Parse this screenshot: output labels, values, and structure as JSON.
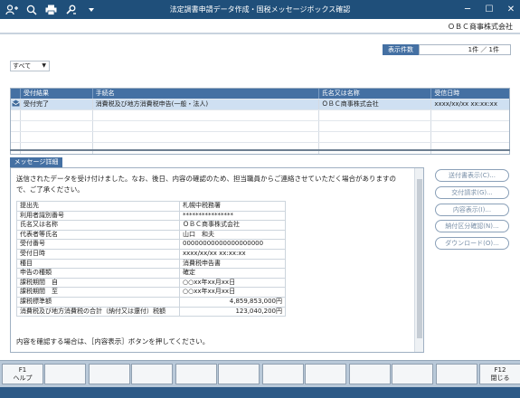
{
  "titlebar": {
    "title": "法定調書申請データ作成・国税メッセージボックス確認",
    "icons": [
      "add-user-icon",
      "search-icon",
      "print-icon",
      "tools-icon",
      "dropdown-icon"
    ],
    "window_controls": [
      "─",
      "☐",
      "✕"
    ]
  },
  "company": "ＯＢＣ商事株式会社",
  "count": {
    "label": "表示件数",
    "value": "1件 ／ 1件"
  },
  "filter": {
    "selected": "すべて"
  },
  "table": {
    "headers": [
      "受付結果",
      "手続名",
      "氏名又は名称",
      "受信日時"
    ],
    "rows": [
      [
        "受付完了",
        "消費税及び地方消費税申告(一般・法人)",
        "ＯＢＣ商事株式会社",
        "xxxx/xx/xx xx:xx:xx"
      ]
    ]
  },
  "detail": {
    "tab_label": "メッセージ詳細",
    "message": "送信されたデータを受け付けました。なお、後日、内容の確認のため、担当職員からご連絡させていただく場合がありますので、ご了承ください。",
    "fields": [
      {
        "k": "提出先",
        "v": "札幌中税務署"
      },
      {
        "k": "利用者識別番号",
        "v": "****************"
      },
      {
        "k": "氏名又は名称",
        "v": "ＯＢＣ商事株式会社"
      },
      {
        "k": "代表者等氏名",
        "v": "山口　和夫"
      },
      {
        "k": "受付番号",
        "v": "00000000000000000000"
      },
      {
        "k": "受付日時",
        "v": "xxxx/xx/xx xx:xx:xx"
      },
      {
        "k": "種目",
        "v": "消費税申告書"
      },
      {
        "k": "申告の種類",
        "v": "確定"
      },
      {
        "k": "課税期間　自",
        "v": "○○xx年xx月xx日"
      },
      {
        "k": "課税期間　至",
        "v": "○○xx年xx月xx日"
      },
      {
        "k": "課税標準額",
        "v": "4,859,853,000円"
      },
      {
        "k": "消費税及び地方消費税の合計（納付又は還付）税額",
        "v": "123,040,200円"
      }
    ],
    "footer": "内容を確認する場合は、［内容表示］ボタンを押してください。"
  },
  "side_buttons": [
    "送付書表示(C)...",
    "交付請求(G)...",
    "内容表示(I)...",
    "納付区分確認(N)...",
    "ダウンロード(O)..."
  ],
  "fkeys": [
    {
      "key": "F1",
      "label": "ヘルプ"
    },
    {
      "key": "",
      "label": ""
    },
    {
      "key": "",
      "label": ""
    },
    {
      "key": "",
      "label": ""
    },
    {
      "key": "",
      "label": ""
    },
    {
      "key": "",
      "label": ""
    },
    {
      "key": "",
      "label": ""
    },
    {
      "key": "",
      "label": ""
    },
    {
      "key": "",
      "label": ""
    },
    {
      "key": "",
      "label": ""
    },
    {
      "key": "",
      "label": ""
    },
    {
      "key": "F12",
      "label": "閉じる"
    }
  ],
  "colors": {
    "titlebar": "#1f4f7a",
    "header": "#4470a3",
    "selected_row": "#cfe0f2",
    "fkey_bar": "#b9c9d9"
  }
}
